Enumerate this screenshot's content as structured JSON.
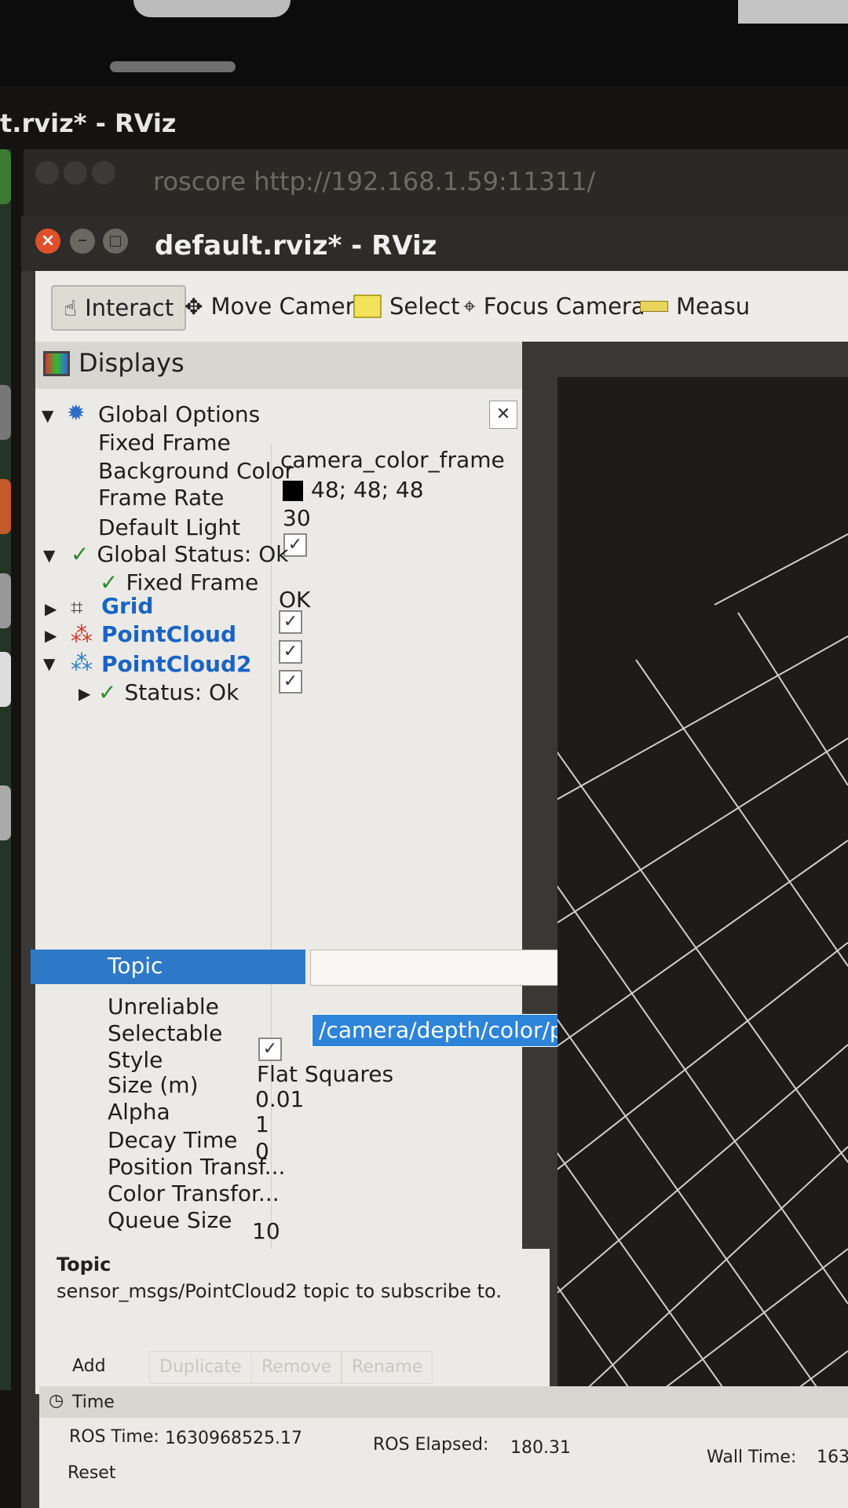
{
  "background_window": {
    "title": "t.rviz* - RViz",
    "terminal_title": "roscore http://192.168.1.59:11311/"
  },
  "window": {
    "title": "default.rviz* - RViz",
    "close_glyph": "×",
    "minimize_glyph": "–",
    "maximize_glyph": "□"
  },
  "toolbar": {
    "tools": [
      {
        "label": "Interact",
        "icon": "hand-icon",
        "active": true
      },
      {
        "label": "Move Camera",
        "icon": "move-camera-icon"
      },
      {
        "label": "Select",
        "icon": "select-box-icon"
      },
      {
        "label": "Focus Camera",
        "icon": "focus-target-icon"
      },
      {
        "label": "Measu",
        "icon": "ruler-icon"
      }
    ]
  },
  "displays": {
    "header": "Displays",
    "close_glyph": "✕",
    "global_options": {
      "label": "Global Options",
      "fixed_frame_label": "Fixed Frame",
      "fixed_frame_value": "camera_color_frame",
      "background_color_label": "Background Color",
      "background_color_value": "48; 48; 48",
      "background_color_hex": "#000000",
      "frame_rate_label": "Frame Rate",
      "frame_rate_value": "30",
      "default_light_label": "Default Light",
      "default_light_checked": true
    },
    "global_status": {
      "label": "Global Status: Ok",
      "fixed_frame_label": "Fixed Frame",
      "fixed_frame_value": "OK"
    },
    "items": [
      {
        "label": "Grid",
        "checked": true,
        "icon": "grid-icon"
      },
      {
        "label": "PointCloud",
        "checked": true,
        "icon": "pointcloud-icon",
        "color": "#d0392b"
      },
      {
        "label": "PointCloud2",
        "checked": true,
        "icon": "pointcloud2-icon",
        "color": "#2d7fd1"
      }
    ],
    "pointcloud2_props": {
      "status_label": "Status: Ok",
      "topic_label": "Topic",
      "topic_option": "/camera/depth/color/points",
      "unreliable_label": "Unreliable",
      "selectable_label": "Selectable",
      "selectable_checked": true,
      "style_label": "Style",
      "style_value": "Flat Squares",
      "size_label": "Size (m)",
      "size_value": "0.01",
      "alpha_label": "Alpha",
      "alpha_value": "1",
      "decay_label": "Decay Time",
      "decay_value": "0",
      "position_transformer_label": "Position Transf...",
      "color_transformer_label": "Color Transfor...",
      "queue_label": "Queue Size",
      "queue_value": "10"
    }
  },
  "help": {
    "title": "Topic",
    "text": "sensor_msgs/PointCloud2 topic to subscribe to."
  },
  "panel_buttons": {
    "add": "Add",
    "duplicate": "Duplicate",
    "remove": "Remove",
    "rename": "Rename"
  },
  "time": {
    "header": "Time",
    "ros_time_label": "ROS Time:",
    "ros_time_value": "1630968525.17",
    "ros_elapsed_label": "ROS Elapsed:",
    "ros_elapsed_value": "180.31",
    "wall_time_label": "Wall Time:",
    "wall_time_value": "163",
    "reset": "Reset"
  },
  "colors": {
    "selection_blue": "#2d79c7",
    "display_name_blue": "#1a63c6",
    "status_green": "#2a8a2a",
    "close_button_orange": "#e0502a",
    "grid_line": "#cfcfcf"
  }
}
